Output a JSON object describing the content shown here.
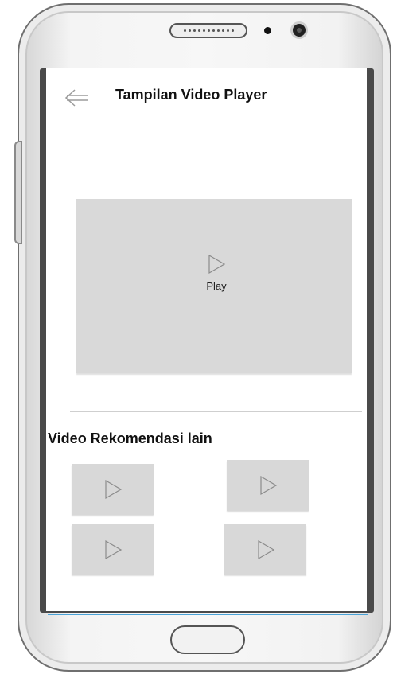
{
  "header": {
    "title": "Tampilan Video Player",
    "back_icon": "back-arrow-icon"
  },
  "player": {
    "play_label": "Play",
    "play_icon": "play-icon"
  },
  "recommendations": {
    "title": "Video Rekomendasi lain",
    "items": [
      {
        "icon": "play-icon"
      },
      {
        "icon": "play-icon"
      },
      {
        "icon": "play-icon"
      },
      {
        "icon": "play-icon"
      }
    ]
  },
  "colors": {
    "screen_background": "#ffffff",
    "placeholder": "#d9d9d9",
    "nav_accent": "#4aa3d8",
    "device_frame": "#4a4a4a"
  }
}
